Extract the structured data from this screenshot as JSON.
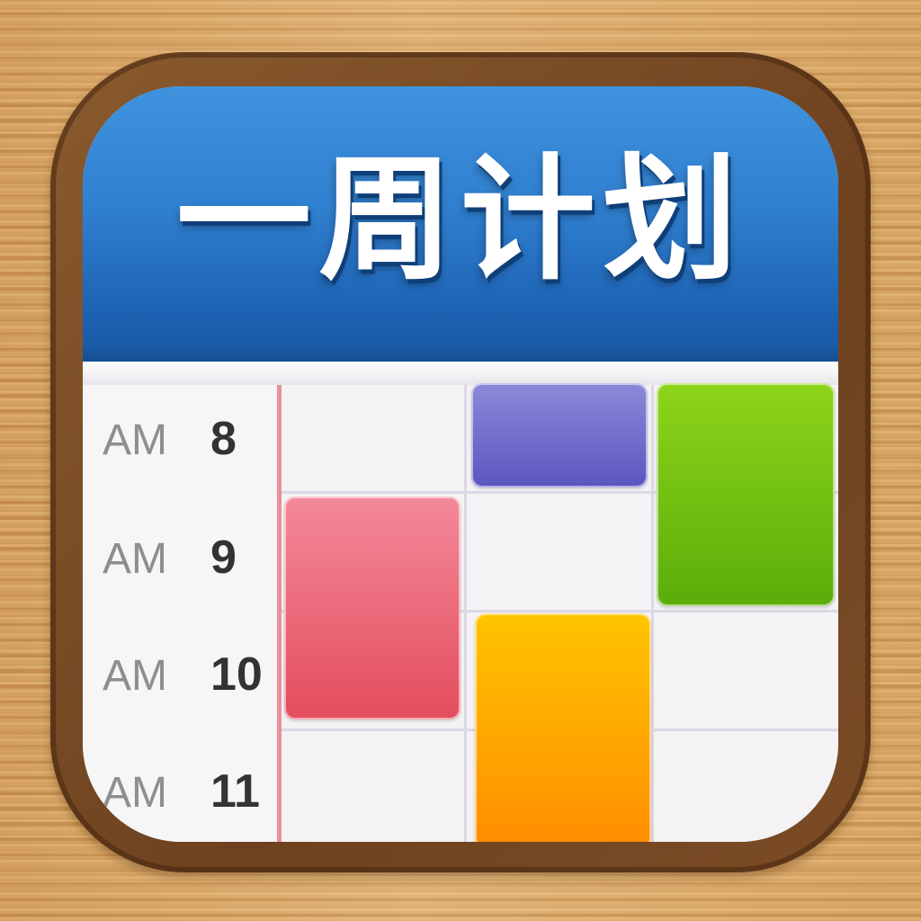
{
  "app": {
    "title": "一周计划"
  },
  "schedule": {
    "times": [
      {
        "ampm": "AM",
        "hour": "8"
      },
      {
        "ampm": "AM",
        "hour": "9"
      },
      {
        "ampm": "AM",
        "hour": "10"
      },
      {
        "ampm": "AM",
        "hour": "11"
      }
    ]
  },
  "colors": {
    "header_blue": "#2f7fcf",
    "wood": "#d9a563",
    "frame_brown": "#7b4c25",
    "today_line": "#e9919b",
    "event_purple": "#6f6ac9",
    "event_green": "#72c012",
    "event_pink": "#ea6676",
    "event_orange": "#ffa600"
  }
}
